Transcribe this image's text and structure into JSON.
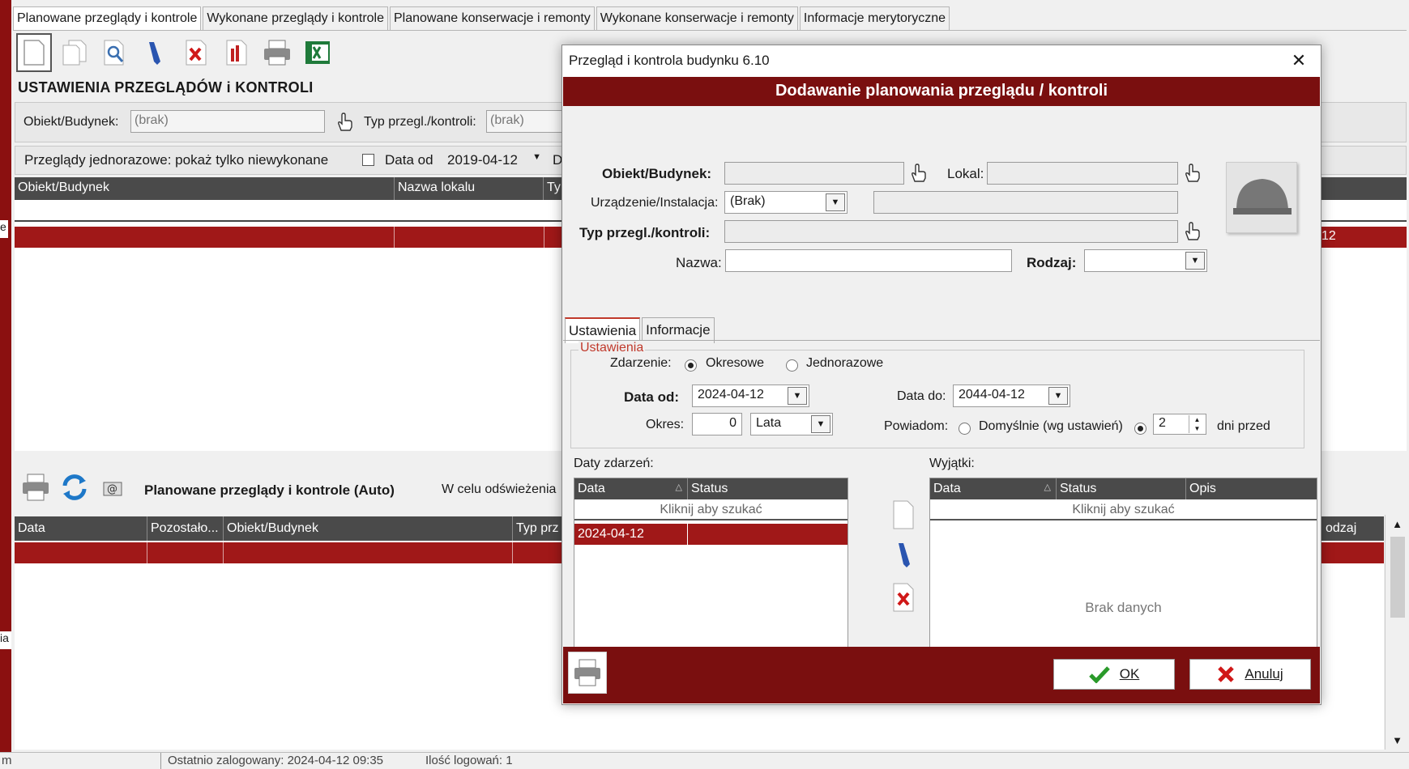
{
  "tabs": [
    {
      "label": "Planowane przeglądy i kontrole",
      "active": true
    },
    {
      "label": "Wykonane przeglądy i kontrole",
      "active": false
    },
    {
      "label": "Planowane konserwacje i remonty",
      "active": false
    },
    {
      "label": "Wykonane konserwacje i remonty",
      "active": false
    },
    {
      "label": "Informacje merytoryczne",
      "active": false
    }
  ],
  "main": {
    "section_title": "USTAWIENIA PRZEGLĄDÓW i KONTROLI",
    "obiekt_label": "Obiekt/Budynek:",
    "obiekt_value": "(brak)",
    "typ_label": "Typ przegl./kontroli:",
    "typ_value": "(brak)",
    "jednorazowe_label": "Przeglądy jednorazowe: pokaż tylko niewykonane",
    "data_od_label": "Data od",
    "data_od_value": "2019-04-12",
    "data_do_cut": "D",
    "grid_columns": [
      "Obiekt/Budynek",
      "Nazwa lokalu",
      "Ty"
    ],
    "side_label_e": "e",
    "side_label_ia": "ia",
    "row_right_text": "12",
    "auto_title": "Planowane przeglądy i kontrole (Auto)",
    "auto_note": "W celu odświeżenia",
    "grid2_columns": [
      "Data",
      "Pozostało...",
      "Obiekt/Budynek",
      "Typ prz"
    ],
    "grid2_right_col": "odzaj"
  },
  "status": {
    "left": "m",
    "last_login": "Ostatnio zalogowany: 2024-04-12 09:35",
    "login_count": "Ilość logowań: 1"
  },
  "dialog": {
    "title": "Przegląd i kontrola budynku  6.10",
    "header": "Dodawanie planowania przeglądu / kontroli",
    "obiekt_label": "Obiekt/Budynek:",
    "lokal_label": "Lokal:",
    "urzadzenie_label": "Urządzenie/Instalacja:",
    "urzadzenie_value": "(Brak)",
    "typ_label": "Typ przegl./kontroli:",
    "nazwa_label": "Nazwa:",
    "rodzaj_label": "Rodzaj:",
    "subtabs": [
      "Ustawienia",
      "Informacje"
    ],
    "group_title": "Ustawienia",
    "zdarzenie_label": "Zdarzenie:",
    "okresowe": "Okresowe",
    "jednorazowe": "Jednorazowe",
    "data_od_label": "Data od:",
    "data_od_value": "2024-04-12",
    "data_do_label": "Data do:",
    "data_do_value": "2044-04-12",
    "okres_label": "Okres:",
    "okres_value": "0",
    "okres_unit": "Lata",
    "powiadom_label": "Powiadom:",
    "domyslnie": "Domyślnie (wg ustawień)",
    "dni_value": "2",
    "dni_przed": "dni przed",
    "daty_label": "Daty zdarzeń:",
    "daty_columns": [
      "Data",
      "Status"
    ],
    "search_hint": "Kliknij aby szukać",
    "daty_rows": [
      {
        "data": "2024-04-12",
        "status": ""
      }
    ],
    "wyjatki_label": "Wyjątki:",
    "wyjatki_columns": [
      "Data",
      "Status",
      "Opis"
    ],
    "brak_danych": "Brak danych",
    "ok_label": "OK",
    "cancel_label": "Anuluj"
  },
  "colors": {
    "accent": "#7a0f0f",
    "row_selected": "#a01818",
    "grid_header": "#4a4a4a"
  }
}
